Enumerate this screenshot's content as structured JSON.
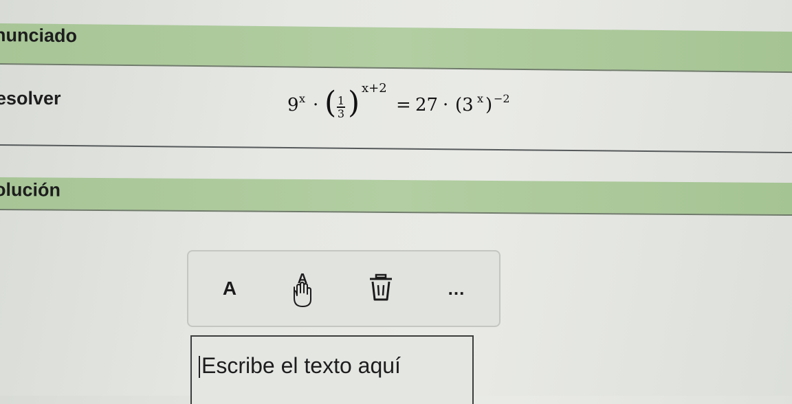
{
  "sections": {
    "statement_title": "nunciado",
    "solution_title": "olución"
  },
  "task": {
    "label": "esolver",
    "equation": {
      "lhs_base": "9",
      "lhs_exp": "x",
      "dot1": "·",
      "frac_num": "1",
      "frac_den": "3",
      "paren_exp": "x+2",
      "equals": "=",
      "rhs_coef": "27",
      "dot2": "·",
      "rhs_base": "(3",
      "rhs_inner_exp": "x",
      "rhs_close": ")",
      "rhs_exp": "−2"
    }
  },
  "toolbar": {
    "text_tool_label": "A",
    "more_label": "...",
    "icons": [
      "hand-text-icon",
      "trash-icon"
    ]
  },
  "editor": {
    "placeholder": "Escribe el texto aquí"
  }
}
